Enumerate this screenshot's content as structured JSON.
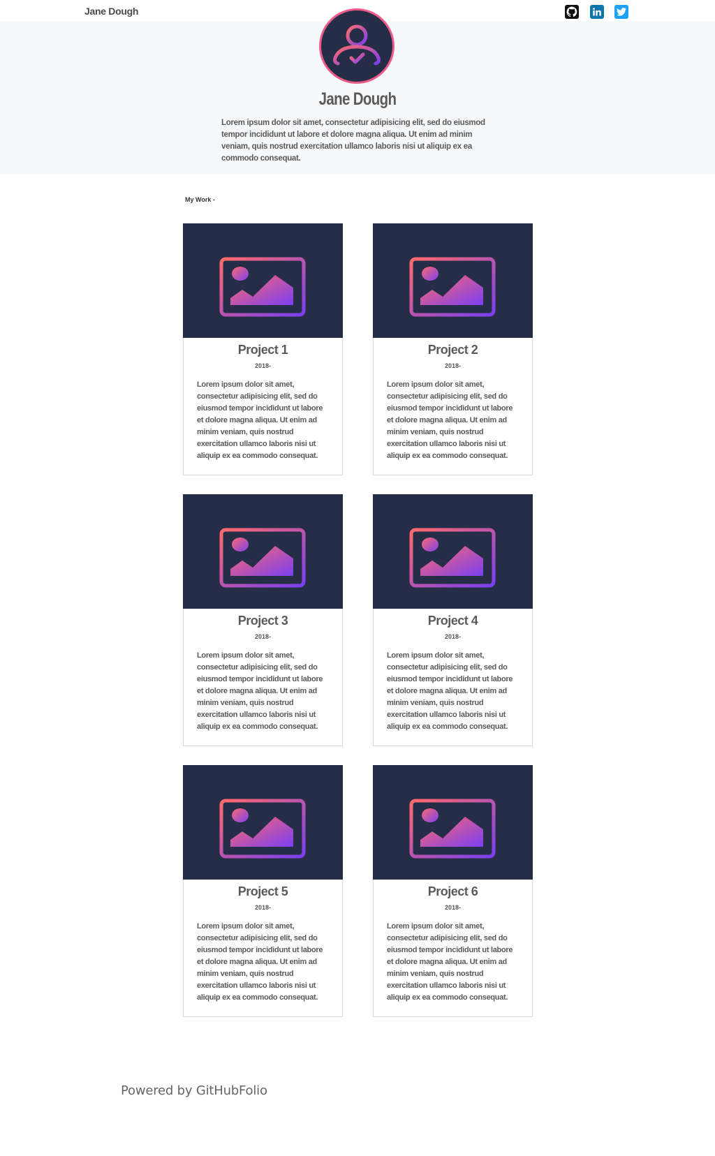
{
  "header": {
    "brand": "Jane Dough",
    "social": [
      {
        "name": "github",
        "icon": "github-icon"
      },
      {
        "name": "linkedin",
        "icon": "linkedin-icon"
      },
      {
        "name": "twitter",
        "icon": "twitter-icon"
      }
    ]
  },
  "hero": {
    "avatar_icon": "user-check-icon",
    "name": "Jane Dough",
    "bio": "Lorem ipsum dolor sit amet, consectetur adipisicing elit, sed do eiusmod tempor incididunt ut labore et dolore magna aliqua. Ut enim ad minim veniam, quis nostrud exercitation ullamco laboris nisi ut aliquip ex ea commodo consequat."
  },
  "work": {
    "title": "My Work -",
    "projects": [
      {
        "title": "Project 1",
        "year": "2018-",
        "description": "Lorem ipsum dolor sit amet, consectetur adipisicing elit, sed do eiusmod tempor incididunt ut labore et dolore magna aliqua. Ut enim ad minim veniam, quis nostrud exercitation ullamco laboris nisi ut aliquip ex ea commodo consequat."
      },
      {
        "title": "Project 2",
        "year": "2018-",
        "description": "Lorem ipsum dolor sit amet, consectetur adipisicing elit, sed do eiusmod tempor incididunt ut labore et dolore magna aliqua. Ut enim ad minim veniam, quis nostrud exercitation ullamco laboris nisi ut aliquip ex ea commodo consequat."
      },
      {
        "title": "Project 3",
        "year": "2018-",
        "description": "Lorem ipsum dolor sit amet, consectetur adipisicing elit, sed do eiusmod tempor incididunt ut labore et dolore magna aliqua. Ut enim ad minim veniam, quis nostrud exercitation ullamco laboris nisi ut aliquip ex ea commodo consequat."
      },
      {
        "title": "Project 4",
        "year": "2018-",
        "description": "Lorem ipsum dolor sit amet, consectetur adipisicing elit, sed do eiusmod tempor incididunt ut labore et dolore magna aliqua. Ut enim ad minim veniam, quis nostrud exercitation ullamco laboris nisi ut aliquip ex ea commodo consequat."
      },
      {
        "title": "Project 5",
        "year": "2018-",
        "description": "Lorem ipsum dolor sit amet, consectetur adipisicing elit, sed do eiusmod tempor incididunt ut labore et dolore magna aliqua. Ut enim ad minim veniam, quis nostrud exercitation ullamco laboris nisi ut aliquip ex ea commodo consequat."
      },
      {
        "title": "Project 6",
        "year": "2018-",
        "description": "Lorem ipsum dolor sit amet, consectetur adipisicing elit, sed do eiusmod tempor incididunt ut labore et dolore magna aliqua. Ut enim ad minim veniam, quis nostrud exercitation ullamco laboris nisi ut aliquip ex ea commodo consequat."
      }
    ],
    "thumbnail_icon": "image-icon"
  },
  "footer": {
    "text": "Powered by GitHubFolio"
  },
  "colors": {
    "thumb_bg": "#262d47",
    "gradient_start": "#ff6a6a",
    "gradient_end": "#7b3ff2",
    "github": "#111111",
    "linkedin": "#0e76a8",
    "twitter": "#1da1f2"
  }
}
